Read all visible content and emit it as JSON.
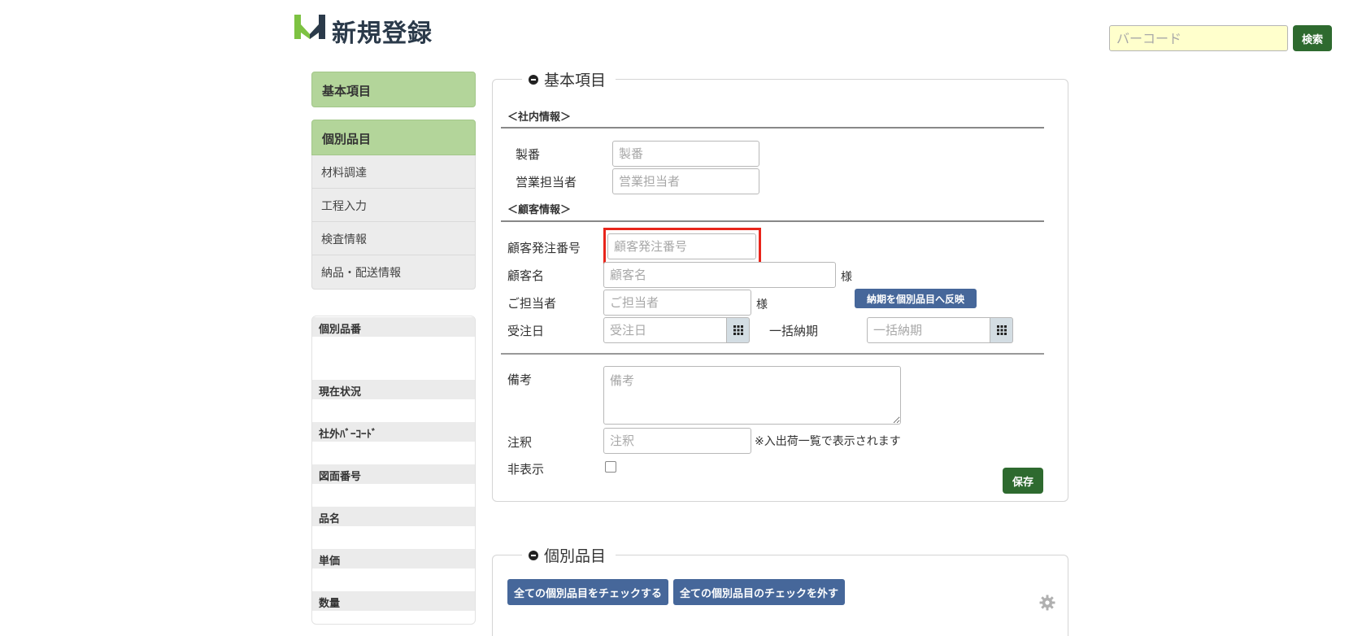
{
  "header": {
    "title": "新規登録",
    "barcode_placeholder": "バーコード",
    "search_label": "検索"
  },
  "colors": {
    "accent_green": "#2e6a2f",
    "logo_green": "#7dc242",
    "sidebar_green": "#b3d59a",
    "button_blue": "#46679a",
    "highlight_red": "#e8251b",
    "barcode_bg": "#ffffcc"
  },
  "sidebar": {
    "section_basic": "基本項目",
    "section_individual": "個別品目",
    "items": [
      {
        "label": "材料調達"
      },
      {
        "label": "工程入力"
      },
      {
        "label": "検査情報"
      },
      {
        "label": "納品・配送情報"
      }
    ],
    "info_labels": [
      "個別品番",
      "現在状況",
      "社外ﾊﾞｰｺｰﾄﾞ",
      "図面番号",
      "品名",
      "単価",
      "数量"
    ]
  },
  "basic": {
    "legend": "基本項目",
    "internal_heading": "＜社内情報＞",
    "seiban_label": "製番",
    "seiban_placeholder": "製番",
    "sales_label": "営業担当者",
    "sales_placeholder": "営業担当者",
    "customer_heading": "＜顧客情報＞",
    "order_no_label": "顧客発注番号",
    "order_no_placeholder": "顧客発注番号",
    "customer_name_label": "顧客名",
    "customer_name_placeholder": "顧客名",
    "honorific_1": "様",
    "contact_label": "ご担当者",
    "contact_placeholder": "ご担当者",
    "honorific_2": "様",
    "reflect_button": "納期を個別品目へ反映",
    "order_date_label": "受注日",
    "order_date_placeholder": "受注日",
    "bulk_delivery_label": "一括納期",
    "bulk_delivery_placeholder": "一括納期",
    "remarks_label": "備考",
    "remarks_placeholder": "備考",
    "note_label": "注釈",
    "note_placeholder": "注釈",
    "note_hint": "※入出荷一覧で表示されます",
    "hidden_label": "非表示",
    "save_button": "保存"
  },
  "individual": {
    "legend": "個別品目",
    "check_all_button": "全ての個別品目をチェックする",
    "uncheck_all_button": "全ての個別品目のチェックを外す"
  }
}
